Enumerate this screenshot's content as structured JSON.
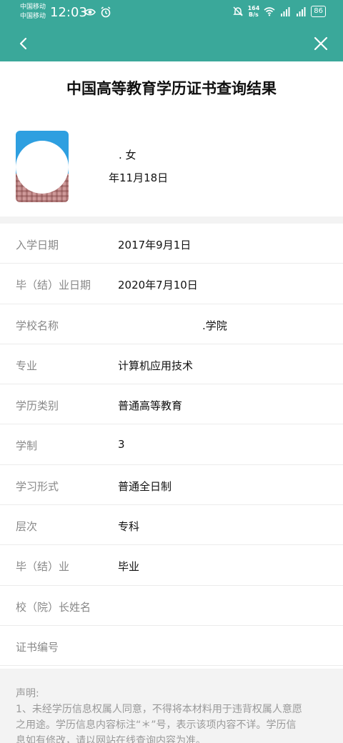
{
  "status_bar": {
    "carrier_1": "中国移动",
    "carrier_2": "中国移动",
    "time": "12:03",
    "net_speed_value": "164",
    "net_speed_unit": "B/s",
    "battery": "86"
  },
  "nav": {
    "back_icon": "chevron-left-icon",
    "close_icon": "close-icon"
  },
  "page_title": "中国高等教育学历证书查询结果",
  "profile": {
    "gender": ". 女",
    "birth_date": "年11月18日"
  },
  "details": [
    {
      "label": "入学日期",
      "value": "2017年9月1日"
    },
    {
      "label": "毕（结）业日期",
      "value": "2020年7月10日"
    },
    {
      "label": "学校名称",
      "value": ".学院"
    },
    {
      "label": "专业",
      "value": "计算机应用技术"
    },
    {
      "label": "学历类别",
      "value": "普通高等教育"
    },
    {
      "label": "学制",
      "value": "3"
    },
    {
      "label": "学习形式",
      "value": "普通全日制"
    },
    {
      "label": "层次",
      "value": "专科"
    },
    {
      "label": "毕（结）业",
      "value": "毕业"
    },
    {
      "label": "校（院）长姓名",
      "value": ""
    },
    {
      "label": "证书编号",
      "value": ""
    }
  ],
  "notice": {
    "heading": "声明:",
    "line_1": "1、未经学历信息权属人同意，不得将本材料用于违背权属人意愿",
    "line_2": "之用途。学历信息内容标注“＊”号，表示该项内容不详。学历信",
    "line_3": "息如有修改，请以网站在线查询内容为准。"
  },
  "colors": {
    "header": "#3aa89a",
    "label": "#888888",
    "value": "#111111"
  }
}
